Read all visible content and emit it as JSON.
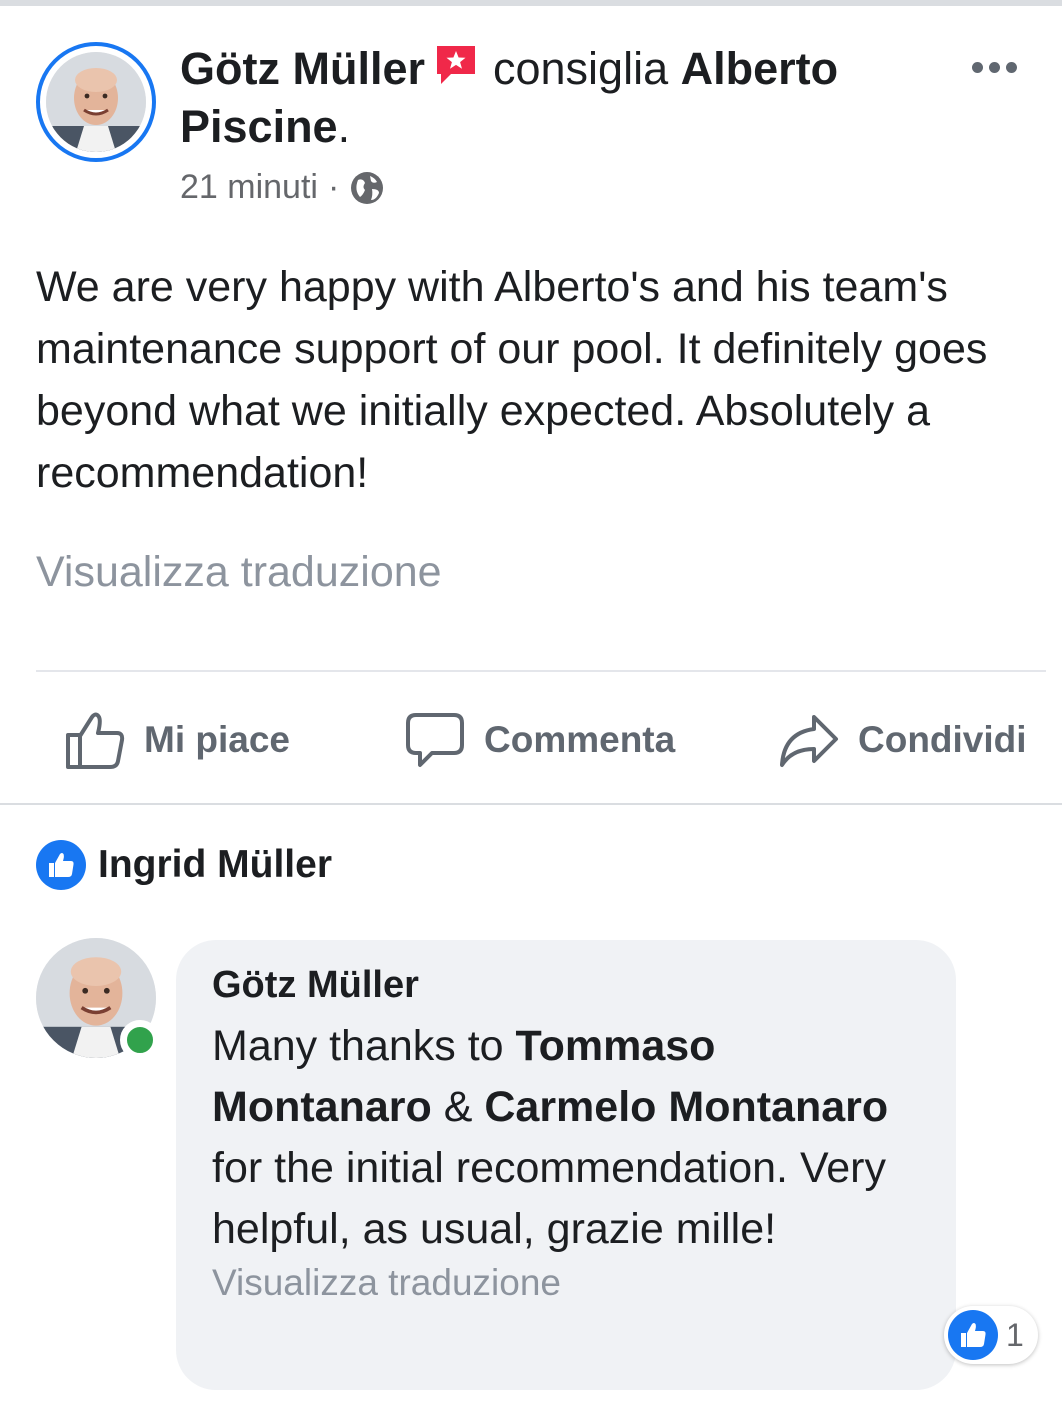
{
  "post": {
    "author": "Götz Müller",
    "verb": "consiglia",
    "page_name": "Alberto Piscine",
    "page_suffix": ".",
    "time": "21 minuti",
    "separator": "·",
    "privacy_icon": "globe-icon",
    "body": "We are very happy with Alberto's and his team's maintenance support of our pool. It definitely goes beyond what we initially expected. Absolutely a recommendation!",
    "translate": "Visualizza traduzione"
  },
  "actions": {
    "like": "Mi piace",
    "comment": "Commenta",
    "share": "Condividi"
  },
  "likes": {
    "name": "Ingrid Müller"
  },
  "comment": {
    "author": "Götz Müller",
    "text_1": "Many thanks to ",
    "mention_1": "Tommaso Montanaro",
    "text_2": " & ",
    "mention_2": "Carmelo Montanaro",
    "text_3": " for the initial recommendation. Very helpful, as usual, grazie mille!",
    "translate": "Visualizza traduzione",
    "reaction_count": "1"
  },
  "colors": {
    "accent": "#1877f2",
    "recommend_flag": "#f02849",
    "online": "#31a24c"
  }
}
